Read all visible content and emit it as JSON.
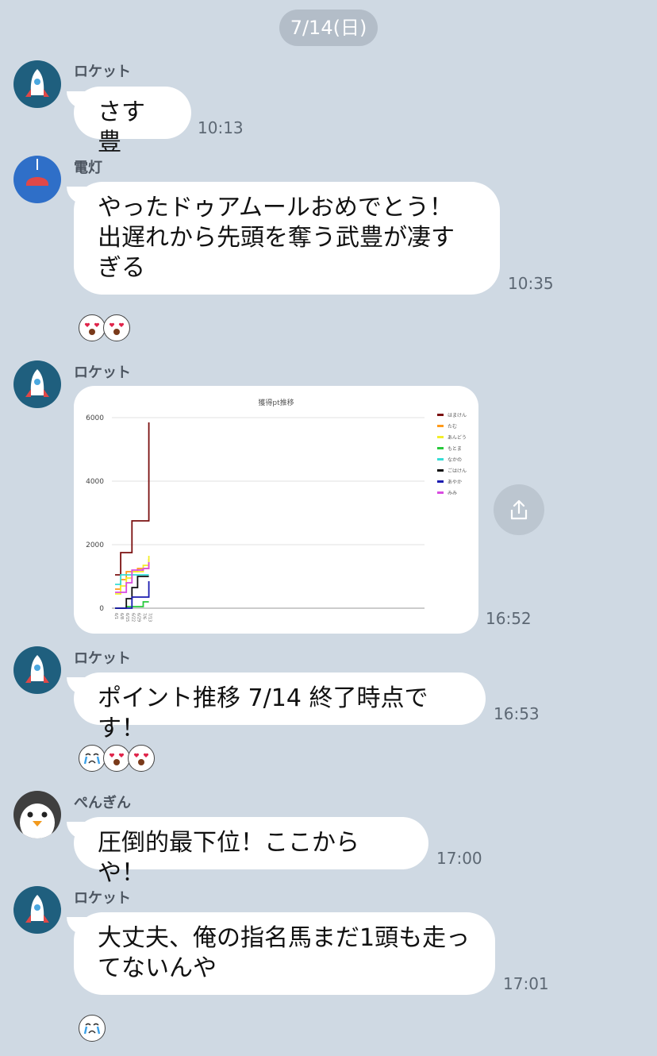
{
  "date_label": "7/14(日)",
  "messages": [
    {
      "sender": "ロケット",
      "text": "さす豊",
      "time": "10:13"
    },
    {
      "sender": "電灯",
      "text": "やったドゥアムールおめでとう！\n出遅れから先頭を奪う武豊が凄すぎる",
      "time": "10:35"
    },
    {
      "sender": "ロケット",
      "time": "16:52"
    },
    {
      "sender": "ロケット",
      "text": "ポイント推移 7/14 終了時点です！",
      "time": "16:53"
    },
    {
      "sender": "ぺんぎん",
      "text": "圧倒的最下位！ここからや！",
      "time": "17:00"
    },
    {
      "sender": "ロケット",
      "text": "大丈夫、俺の指名馬まだ1頭も走ってないんや",
      "time": "17:01"
    }
  ],
  "reactions": {
    "r1": [
      "heart-eyes",
      "heart-eyes"
    ],
    "r2": [
      "crying",
      "heart-eyes",
      "heart-eyes"
    ],
    "r3": [
      "crying"
    ]
  },
  "colors": {
    "background": "#cfd9e3",
    "rocket_avatar_bg": "#1f5f7e",
    "lamp_avatar_bg": "#2f6fc8",
    "penguin_avatar_bg": "#3f3f3f"
  },
  "chart_data": {
    "type": "line",
    "title": "獲得pt推移",
    "ylim": [
      0,
      6000
    ],
    "yticks": [
      "0",
      "2000",
      "4000",
      "6000"
    ],
    "x": [
      "6/1",
      "6/8",
      "6/15",
      "6/22",
      "6/29",
      "7/6",
      "7/13"
    ],
    "series": [
      {
        "name": "はまけん",
        "color": "#7b1010",
        "values": [
          1050,
          1750,
          1750,
          2750,
          2750,
          2750,
          5850
        ]
      },
      {
        "name": "たむ",
        "color": "#ff9a1a",
        "values": [
          600,
          900,
          1150,
          1150,
          1250,
          1250,
          1550
        ]
      },
      {
        "name": "あんどう",
        "color": "#f3ee2a",
        "values": [
          450,
          700,
          950,
          1150,
          1150,
          1350,
          1650
        ]
      },
      {
        "name": "もとま",
        "color": "#27c93a",
        "values": [
          0,
          0,
          50,
          50,
          50,
          200,
          200
        ]
      },
      {
        "name": "なかの",
        "color": "#35ddd6",
        "values": [
          750,
          1050,
          1050,
          1050,
          1050,
          1050,
          1050
        ]
      },
      {
        "name": "ごはけん",
        "color": "#111111",
        "values": [
          0,
          0,
          300,
          650,
          1000,
          1000,
          1000
        ]
      },
      {
        "name": "あやか",
        "color": "#1b1bb0",
        "values": [
          0,
          0,
          0,
          350,
          350,
          350,
          850
        ]
      },
      {
        "name": "みみ",
        "color": "#d94be0",
        "values": [
          500,
          500,
          800,
          1200,
          1200,
          1250,
          1450
        ]
      }
    ]
  }
}
